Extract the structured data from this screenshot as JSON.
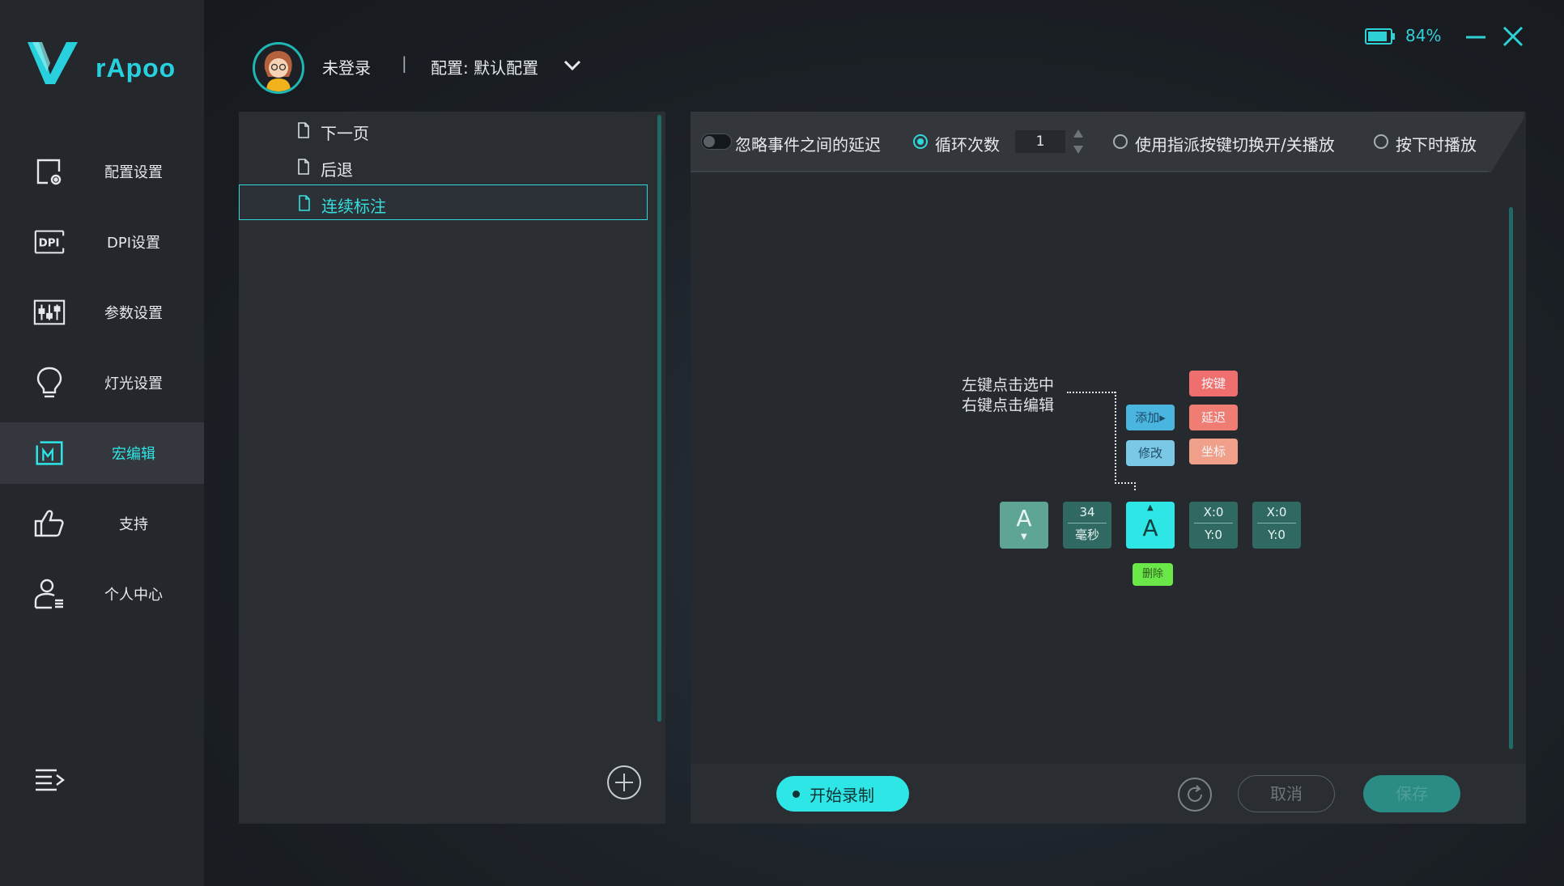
{
  "app": {
    "logo_text": "rApoo"
  },
  "sidebar": {
    "items": [
      {
        "label": "配置设置",
        "icon": "config-icon"
      },
      {
        "label": "DPI设置",
        "icon": "dpi-icon"
      },
      {
        "label": "参数设置",
        "icon": "params-icon"
      },
      {
        "label": "灯光设置",
        "icon": "bulb-icon"
      },
      {
        "label": "宏编辑",
        "icon": "macro-icon",
        "active": true
      },
      {
        "label": "支持",
        "icon": "thumbs-up-icon"
      },
      {
        "label": "个人中心",
        "icon": "user-icon"
      }
    ]
  },
  "header": {
    "user_status": "未登录",
    "separator": "|",
    "config_label": "配置: 默认配置",
    "battery_pct": "84%"
  },
  "macro_list": {
    "items": [
      {
        "name": "下一页"
      },
      {
        "name": "后退"
      },
      {
        "name": "连续标注",
        "selected": true
      }
    ]
  },
  "toolbar": {
    "ignore_delay_label": "忽略事件之间的延迟",
    "loop_label": "循环次数",
    "loop_count": "1",
    "toggle_play_label": "使用指派按键切换开/关播放",
    "hold_play_label": "按下时播放"
  },
  "help": {
    "line1": "左键点击选中",
    "line2": "右键点击编辑",
    "tags": {
      "add": "添加▸",
      "modify": "修改",
      "key": "按键",
      "delay": "延迟",
      "coord": "坐标",
      "delete": "删除"
    },
    "events": [
      {
        "type": "key",
        "label": "A",
        "dir": "▼"
      },
      {
        "type": "delay",
        "value": "34",
        "unit": "毫秒"
      },
      {
        "type": "key-active",
        "label": "A",
        "dir": "▲"
      },
      {
        "type": "coord",
        "x": "X:0",
        "y": "Y:0"
      },
      {
        "type": "coord",
        "x": "X:0",
        "y": "Y:0"
      }
    ]
  },
  "bottom": {
    "record_label": "开始录制",
    "cancel_label": "取消",
    "save_label": "保存"
  },
  "colors": {
    "accent": "#2ee6e6",
    "sidebar_bg": "#24272c",
    "panel_bg": "#2a2d32"
  }
}
